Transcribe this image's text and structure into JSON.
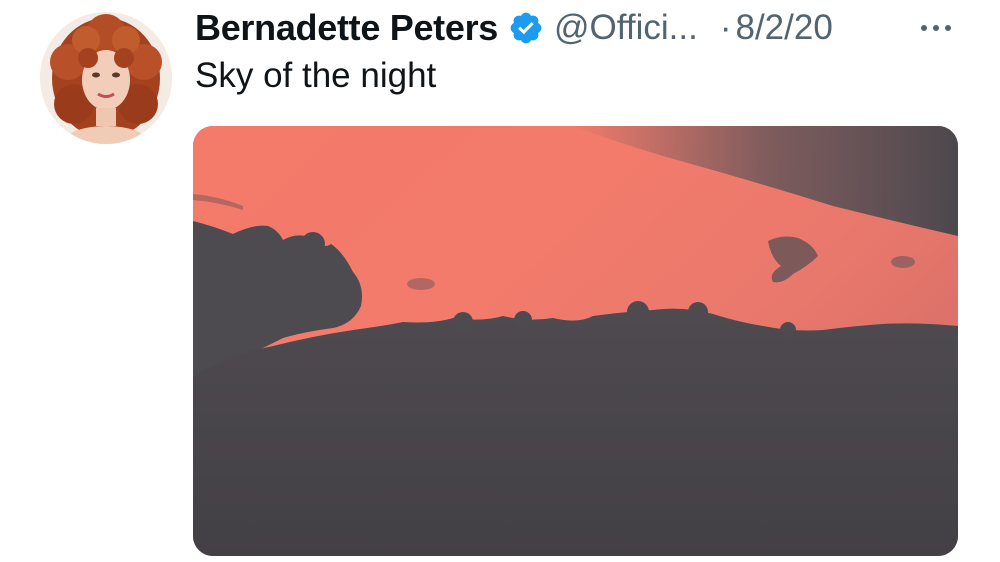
{
  "tweet": {
    "author": {
      "display_name": "Bernadette Peters",
      "handle": "@Offici...",
      "verified": true,
      "avatar_icon": "profile-photo"
    },
    "separator": "·",
    "date": "8/2/20",
    "text": "Sky of the night",
    "more_icon": "more-horizontal-icon",
    "media": {
      "type": "photo",
      "subject": "sunset sky with dark clouds"
    }
  },
  "colors": {
    "text_primary": "#0f1419",
    "text_secondary": "#536471",
    "verified_blue": "#1d9bf0",
    "sky_pink": "#f0776a",
    "cloud_gray": "#4a474c"
  }
}
